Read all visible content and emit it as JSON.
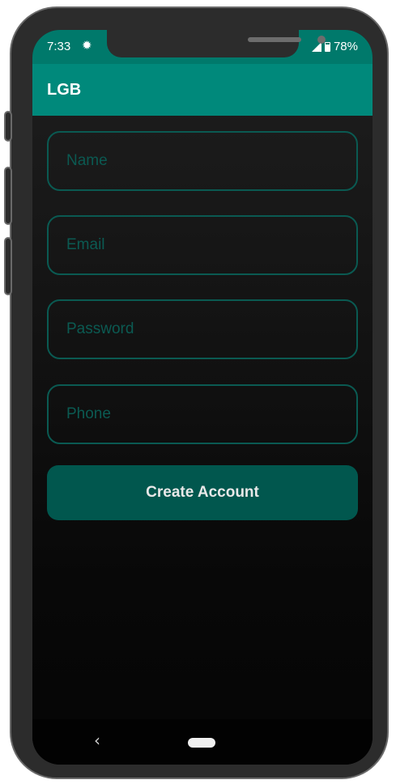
{
  "status_bar": {
    "time": "7:33",
    "battery": "78%",
    "icons": [
      "gear-icon",
      "signal-icon",
      "battery-icon"
    ]
  },
  "app_bar": {
    "title": "LGB",
    "color": "#00897b"
  },
  "form": {
    "name_placeholder": "Name",
    "email_placeholder": "Email",
    "password_placeholder": "Password",
    "phone_placeholder": "Phone",
    "name_value": "",
    "email_value": "",
    "password_value": "",
    "phone_value": "",
    "create_button_label": "Create Account"
  },
  "nav_bar": {
    "back_glyph": "‹"
  },
  "colors": {
    "accent": "#00897b",
    "status": "#00796b",
    "field_border": "#0a5a52",
    "button": "#01574e"
  }
}
